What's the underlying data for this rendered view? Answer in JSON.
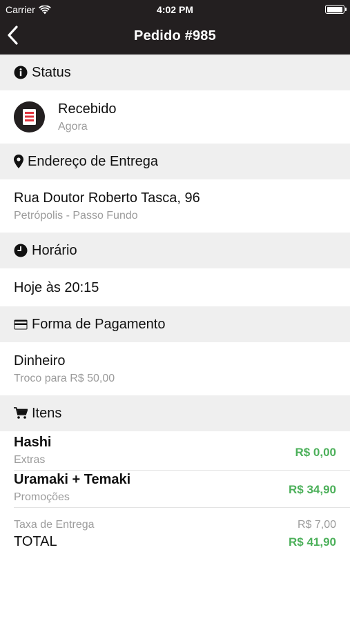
{
  "status_bar": {
    "carrier": "Carrier",
    "time": "4:02 PM",
    "battery_level": 1.0
  },
  "nav": {
    "title": "Pedido #985",
    "back_icon": "chevron-left-icon"
  },
  "sections": {
    "status": {
      "header": "Status",
      "icon": "info-icon",
      "value": "Recebido",
      "sub": "Agora",
      "status_icon": "receipt-icon"
    },
    "address": {
      "header": "Endereço de Entrega",
      "icon": "map-pin-icon",
      "line1": "Rua Doutor Roberto Tasca, 96",
      "line2": "Petrópolis - Passo Fundo"
    },
    "time": {
      "header": "Horário",
      "icon": "clock-icon",
      "value": "Hoje às 20:15"
    },
    "payment": {
      "header": "Forma de Pagamento",
      "icon": "credit-card-icon",
      "method": "Dinheiro",
      "change": "Troco para R$ 50,00"
    },
    "items": {
      "header": "Itens",
      "icon": "cart-icon",
      "list": [
        {
          "name": "Hashi",
          "category": "Extras",
          "price": "R$ 0,00"
        },
        {
          "name": "Uramaki + Temaki",
          "category": "Promoções",
          "price": "R$ 34,90"
        }
      ],
      "delivery_fee_label": "Taxa de Entrega",
      "delivery_fee": "R$ 7,00",
      "total_label": "TOTAL",
      "total": "R$ 41,90"
    }
  },
  "colors": {
    "topbar": "#231f20",
    "header_bg": "#efefef",
    "price_green": "#4cb05a",
    "muted": "#9b9b9b",
    "receipt_red": "#e0333e"
  }
}
